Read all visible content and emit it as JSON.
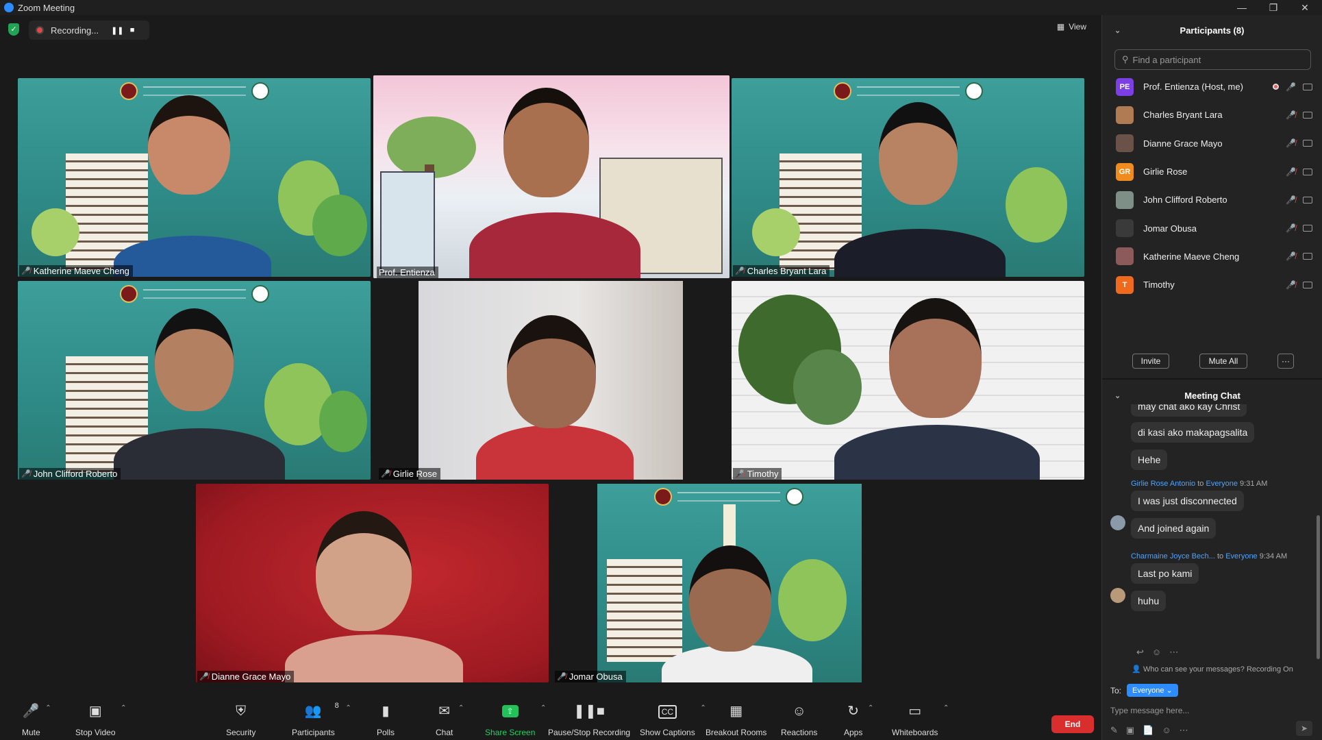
{
  "window": {
    "title": "Zoom Meeting"
  },
  "topbar": {
    "recording_label": "Recording...",
    "view_label": "View"
  },
  "tiles": [
    {
      "name": "Katherine Maeve Cheng"
    },
    {
      "name": "Prof. Entienza"
    },
    {
      "name": "Charles Bryant Lara"
    },
    {
      "name": "John Clifford Roberto"
    },
    {
      "name": "Girlie Rose"
    },
    {
      "name": "Timothy"
    },
    {
      "name": "Dianne Grace Mayo"
    },
    {
      "name": "Jomar Obusa"
    }
  ],
  "toolbar": {
    "mute": "Mute",
    "stop_video": "Stop Video",
    "security": "Security",
    "participants": "Participants",
    "participants_count": "8",
    "polls": "Polls",
    "chat": "Chat",
    "share_screen": "Share Screen",
    "pause_stop_recording": "Pause/Stop Recording",
    "show_captions": "Show Captions",
    "breakout_rooms": "Breakout Rooms",
    "reactions": "Reactions",
    "apps": "Apps",
    "whiteboards": "Whiteboards",
    "end": "End"
  },
  "participants_panel": {
    "title": "Participants (8)",
    "search_placeholder": "Find a participant",
    "list": [
      {
        "name": "Prof. Entienza (Host, me)",
        "initials": "PE",
        "color": "#7b3fe4"
      },
      {
        "name": "Charles Bryant Lara",
        "initials": "",
        "color": "#b07a52"
      },
      {
        "name": "Dianne Grace Mayo",
        "initials": "",
        "color": "#6a5248"
      },
      {
        "name": "Girlie Rose",
        "initials": "GR",
        "color": "#f08c1e"
      },
      {
        "name": "John Clifford Roberto",
        "initials": "",
        "color": "#7d8f86"
      },
      {
        "name": "Jomar Obusa",
        "initials": "",
        "color": "#3a3a3a"
      },
      {
        "name": "Katherine Maeve Cheng",
        "initials": "",
        "color": "#8c5a5a"
      },
      {
        "name": "Timothy",
        "initials": "T",
        "color": "#f06a1e"
      }
    ],
    "invite": "Invite",
    "mute_all": "Mute All",
    "more": "···"
  },
  "chat_panel": {
    "title": "Meeting Chat",
    "messages": [
      {
        "text": "may chat ako kay Christ"
      },
      {
        "text": "di kasi ako makapagsalita"
      },
      {
        "text": "Hehe"
      },
      {
        "sender": "Girlie Rose Antonio",
        "to_word": "to",
        "to": "Everyone",
        "time": "9:31 AM",
        "text": "I was just disconnected"
      },
      {
        "text": "And joined again"
      },
      {
        "sender": "Charmaine Joyce Bech...",
        "to_word": "to",
        "to": "Everyone",
        "time": "9:34 AM",
        "text": "Last po kami"
      },
      {
        "text": "huhu"
      }
    ],
    "visibility_note": "Who can see your messages? Recording On",
    "to_label": "To:",
    "to_value": "Everyone",
    "input_placeholder": "Type message here..."
  },
  "colors": {
    "accent": "#2d8cff",
    "end": "#d92e2e",
    "speaking": "#d9e05a",
    "muted": "#e04848"
  }
}
